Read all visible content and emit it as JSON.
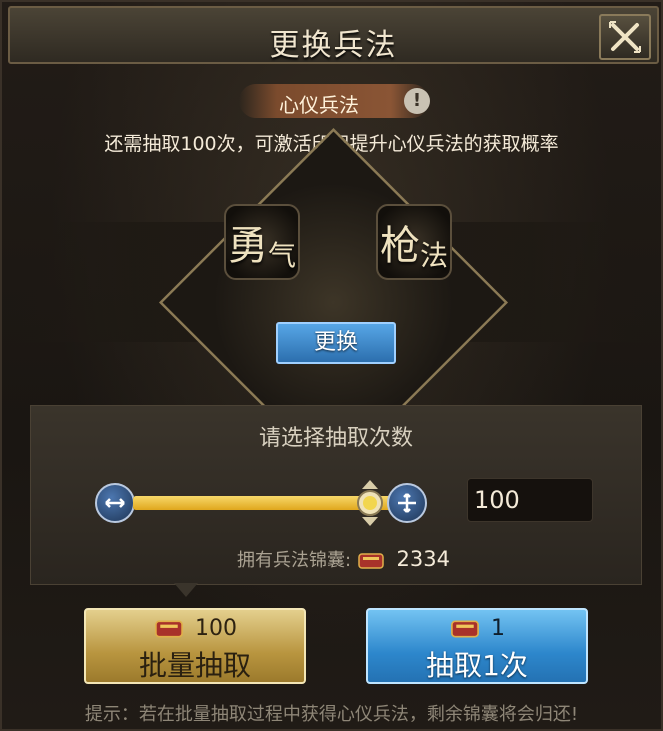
{
  "window": {
    "title": "更换兵法"
  },
  "banner": {
    "pill_label": "心仪兵法",
    "info_icon": "info-icon",
    "hint": "还需抽取100次，可激活印记提升心仪兵法的获取概率"
  },
  "emblem": {
    "left_glyph": "勇",
    "left_glyph_small": "气",
    "right_glyph": "枪",
    "right_glyph_small": "法",
    "swap_label": "更换"
  },
  "selector": {
    "title": "请选择抽取次数",
    "quantity": "100",
    "slider_level": 1.0,
    "owned_label": "拥有兵法锦囊:",
    "owned_count": "2334"
  },
  "actions": {
    "batch": {
      "cost": "100",
      "label": "批量抽取"
    },
    "single": {
      "cost": "1",
      "label": "抽取1次"
    }
  },
  "footer": {
    "tip": "提示：若在批量抽取过程中获得心仪兵法，剩余锦囊将会归还!"
  },
  "colors": {
    "gold_button": "#c9a44f",
    "blue_button": "#3a91d2",
    "slider_fill": "#eec33a"
  }
}
